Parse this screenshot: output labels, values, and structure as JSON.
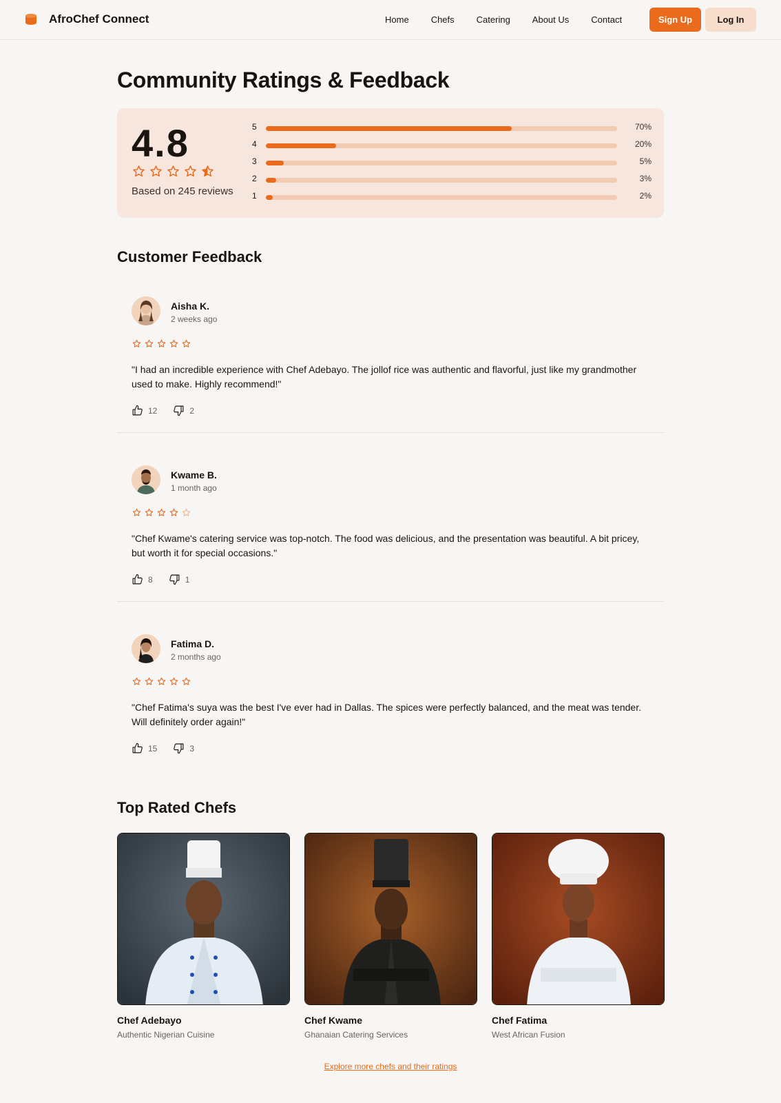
{
  "brand": {
    "name": "AfroChef Connect",
    "accent": "#e96b1b"
  },
  "nav": {
    "items": [
      "Home",
      "Chefs",
      "Catering",
      "About Us",
      "Contact"
    ],
    "signup": "Sign Up",
    "login": "Log In"
  },
  "page_title": "Community Ratings & Feedback",
  "summary": {
    "score": "4.8",
    "star_rating": 4.5,
    "based_on": "Based on 245 reviews",
    "distribution": [
      {
        "label": "5",
        "percent": 70,
        "percent_text": "70%"
      },
      {
        "label": "4",
        "percent": 20,
        "percent_text": "20%"
      },
      {
        "label": "3",
        "percent": 5,
        "percent_text": "5%"
      },
      {
        "label": "2",
        "percent": 3,
        "percent_text": "3%"
      },
      {
        "label": "1",
        "percent": 2,
        "percent_text": "2%"
      }
    ]
  },
  "feedback_title": "Customer Feedback",
  "reviews": [
    {
      "name": "Aisha K.",
      "time": "2 weeks ago",
      "stars": 5,
      "text": "\"I had an incredible experience with Chef Adebayo. The jollof rice was authentic and flavorful, just like my grandmother used to make. Highly recommend!\"",
      "likes": "12",
      "dislikes": "2"
    },
    {
      "name": "Kwame B.",
      "time": "1 month ago",
      "stars": 4,
      "text": "\"Chef Kwame's catering service was top-notch. The food was delicious, and the presentation was beautiful. A bit pricey, but worth it for special occasions.\"",
      "likes": "8",
      "dislikes": "1"
    },
    {
      "name": "Fatima D.",
      "time": "2 months ago",
      "stars": 5,
      "text": "\"Chef Fatima's suya was the best I've ever had in Dallas. The spices were perfectly balanced, and the meat was tender. Will definitely order again!\"",
      "likes": "15",
      "dislikes": "3"
    }
  ],
  "chefs_title": "Top Rated Chefs",
  "chefs": [
    {
      "name": "Chef Adebayo",
      "specialty": "Authentic Nigerian Cuisine"
    },
    {
      "name": "Chef Kwame",
      "specialty": "Ghanaian Catering Services"
    },
    {
      "name": "Chef Fatima",
      "specialty": "West African Fusion"
    }
  ],
  "explore_link": "Explore more chefs and their ratings"
}
